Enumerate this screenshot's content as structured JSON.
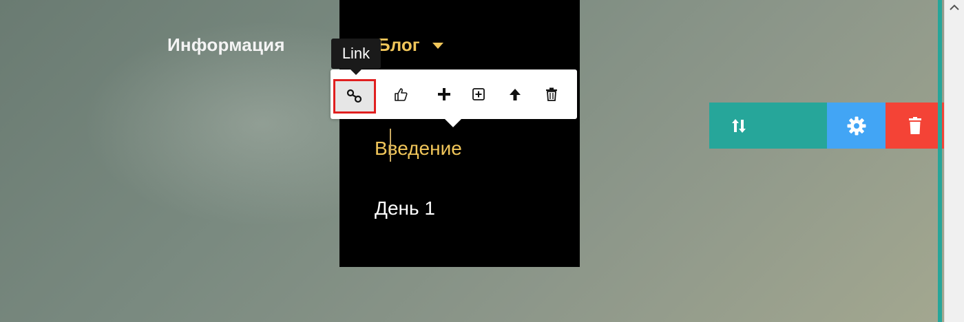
{
  "nav": {
    "info_label": "Информация",
    "blog_label": "Блог",
    "submenu": [
      {
        "label": "Введение"
      },
      {
        "label": "День 1"
      }
    ]
  },
  "tooltip": {
    "text": "Link"
  },
  "toolbar": {
    "buttons": [
      {
        "icon": "link-icon",
        "selected": true
      },
      {
        "icon": "thumbs-up-icon"
      },
      {
        "icon": "plus-icon"
      },
      {
        "icon": "add-square-icon"
      },
      {
        "icon": "arrow-up-icon"
      },
      {
        "icon": "trash-icon"
      }
    ]
  },
  "actions": [
    {
      "icon": "move-up-down-icon",
      "color": "#26a69a"
    },
    {
      "icon": "gear-icon",
      "color": "#42a5f5"
    },
    {
      "icon": "trash-icon",
      "color": "#f44336"
    }
  ],
  "colors": {
    "accent_gold": "#f1c65a",
    "teal": "#26a69a",
    "blue": "#42a5f5",
    "red": "#f44336",
    "selection_outline": "#e01f1f"
  }
}
